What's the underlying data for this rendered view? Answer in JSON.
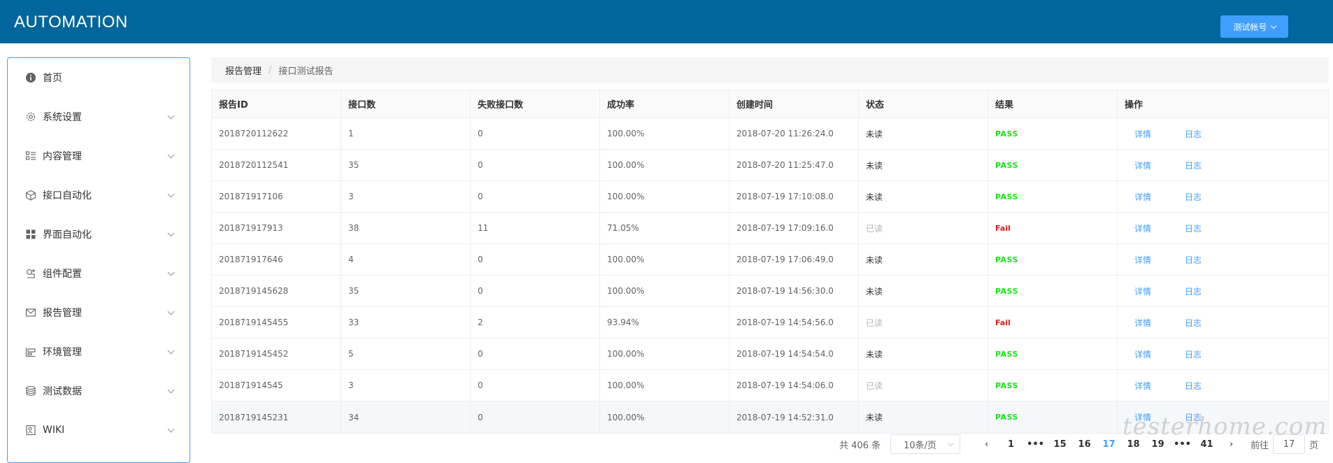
{
  "header": {
    "logo": "AUTOMATION",
    "account_label": "测试帐号"
  },
  "sidebar": {
    "items": [
      {
        "label": "首页",
        "icon": "info-icon"
      },
      {
        "label": "系统设置",
        "icon": "gear-icon"
      },
      {
        "label": "内容管理",
        "icon": "list-icon"
      },
      {
        "label": "接口自动化",
        "icon": "cube-icon"
      },
      {
        "label": "界面自动化",
        "icon": "grid-icon"
      },
      {
        "label": "组件配置",
        "icon": "component-icon"
      },
      {
        "label": "报告管理",
        "icon": "mail-icon"
      },
      {
        "label": "环境管理",
        "icon": "environment-icon"
      },
      {
        "label": "测试数据",
        "icon": "database-icon"
      },
      {
        "label": "WIKI",
        "icon": "wiki-icon"
      }
    ]
  },
  "breadcrumb": {
    "parent": "报告管理",
    "separator": "/",
    "current": "接口测试报告"
  },
  "table": {
    "columns": [
      "报告ID",
      "接口数",
      "失败接口数",
      "成功率",
      "创建时间",
      "状态",
      "结果",
      "操作"
    ],
    "action_detail": "详情",
    "action_log": "日志",
    "rows": [
      {
        "id": "2018720112622",
        "count": "1",
        "failed": "0",
        "rate": "100.00%",
        "created": "2018-07-20 11:26:24.0",
        "status": "未读",
        "result": "PASS"
      },
      {
        "id": "2018720112541",
        "count": "35",
        "failed": "0",
        "rate": "100.00%",
        "created": "2018-07-20 11:25:47.0",
        "status": "未读",
        "result": "PASS"
      },
      {
        "id": "201871917106",
        "count": "3",
        "failed": "0",
        "rate": "100.00%",
        "created": "2018-07-19 17:10:08.0",
        "status": "未读",
        "result": "PASS"
      },
      {
        "id": "201871917913",
        "count": "38",
        "failed": "11",
        "rate": "71.05%",
        "created": "2018-07-19 17:09:16.0",
        "status": "已读",
        "result": "Fail"
      },
      {
        "id": "201871917646",
        "count": "4",
        "failed": "0",
        "rate": "100.00%",
        "created": "2018-07-19 17:06:49.0",
        "status": "未读",
        "result": "PASS"
      },
      {
        "id": "2018719145628",
        "count": "35",
        "failed": "0",
        "rate": "100.00%",
        "created": "2018-07-19 14:56:30.0",
        "status": "未读",
        "result": "PASS"
      },
      {
        "id": "2018719145455",
        "count": "33",
        "failed": "2",
        "rate": "93.94%",
        "created": "2018-07-19 14:54:56.0",
        "status": "已读",
        "result": "Fail"
      },
      {
        "id": "2018719145452",
        "count": "5",
        "failed": "0",
        "rate": "100.00%",
        "created": "2018-07-19 14:54:54.0",
        "status": "未读",
        "result": "PASS"
      },
      {
        "id": "201871914545",
        "count": "3",
        "failed": "0",
        "rate": "100.00%",
        "created": "2018-07-19 14:54:06.0",
        "status": "已读",
        "result": "PASS"
      },
      {
        "id": "2018719145231",
        "count": "34",
        "failed": "0",
        "rate": "100.00%",
        "created": "2018-07-19 14:52:31.0",
        "status": "未读",
        "result": "PASS"
      }
    ]
  },
  "pagination": {
    "total": "共 406 条",
    "page_size": "10条/页",
    "pages": [
      "1",
      "•••",
      "15",
      "16",
      "17",
      "18",
      "19",
      "•••",
      "41"
    ],
    "current": "17",
    "goto_prefix": "前往",
    "goto_value": "17",
    "goto_suffix": "页"
  },
  "watermark": "testerhome.com",
  "colors": {
    "header": "#01669c",
    "accent": "#409eff",
    "pass": "#19e319",
    "fail": "#e41b1b"
  }
}
